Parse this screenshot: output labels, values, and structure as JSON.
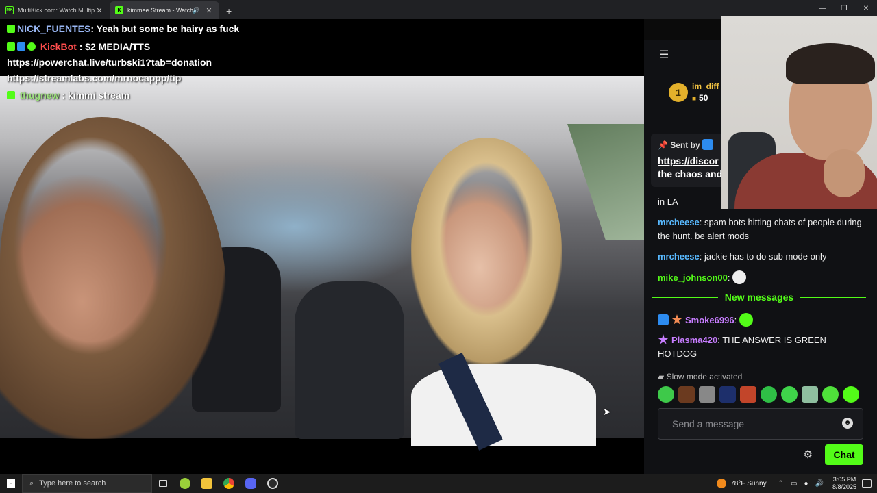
{
  "browser": {
    "tabs": [
      {
        "favicon": "MK",
        "title": "MultiKick.com: Watch Multiple",
        "active": false
      },
      {
        "favicon": "K",
        "title": "kimmee Stream - Watch Live",
        "active": true
      }
    ],
    "new_tab": "+"
  },
  "overlay_chat": [
    {
      "user": "NICK_FUENTES",
      "sep": ":",
      "text": "Yeah but some be hairy as fuck"
    },
    {
      "user": "KickBot",
      "sep": ":",
      "text": "$2 MEDIA/TTS"
    },
    {
      "text": "https://powerchat.live/turbski1?tab=donation"
    },
    {
      "text": "https://streamlabs.com/mrnocappp/tip"
    },
    {
      "user": "thugnew",
      "sep": ":",
      "text": "kimmi stream"
    }
  ],
  "chat": {
    "leaderboard": {
      "rank": "1",
      "name": "im_diff",
      "gifts": "50"
    },
    "pinned": {
      "sent_by": "Sent by",
      "link": "https://discor",
      "desc": "the chaos and"
    },
    "partial_text": "in LA",
    "messages": [
      {
        "user": "mrcheese",
        "text": "spam bots hitting chats of people during the hunt. be alert mods"
      },
      {
        "user": "mrcheese",
        "text": "jackie has to do sub mode only"
      },
      {
        "user": "mike_johnson00",
        "text": ""
      }
    ],
    "new_messages_label": "New messages",
    "new_messages": [
      {
        "user": "Smoke6996",
        "text": ""
      },
      {
        "user": "Plasma420",
        "text": "THE ANSWER IS GREEN HOTDOG"
      }
    ],
    "slow_mode": "Slow mode activated",
    "input_placeholder": "Send a message",
    "chat_button": "Chat"
  },
  "taskbar": {
    "search_placeholder": "Type here to search",
    "weather": "78°F  Sunny",
    "time": "3:05 PM",
    "date": "8/8/2025"
  },
  "colors": {
    "kick_green": "#53fc18",
    "panel_bg": "#101114",
    "username_blue": "#58b9ff",
    "username_purple": "#c77dff"
  }
}
